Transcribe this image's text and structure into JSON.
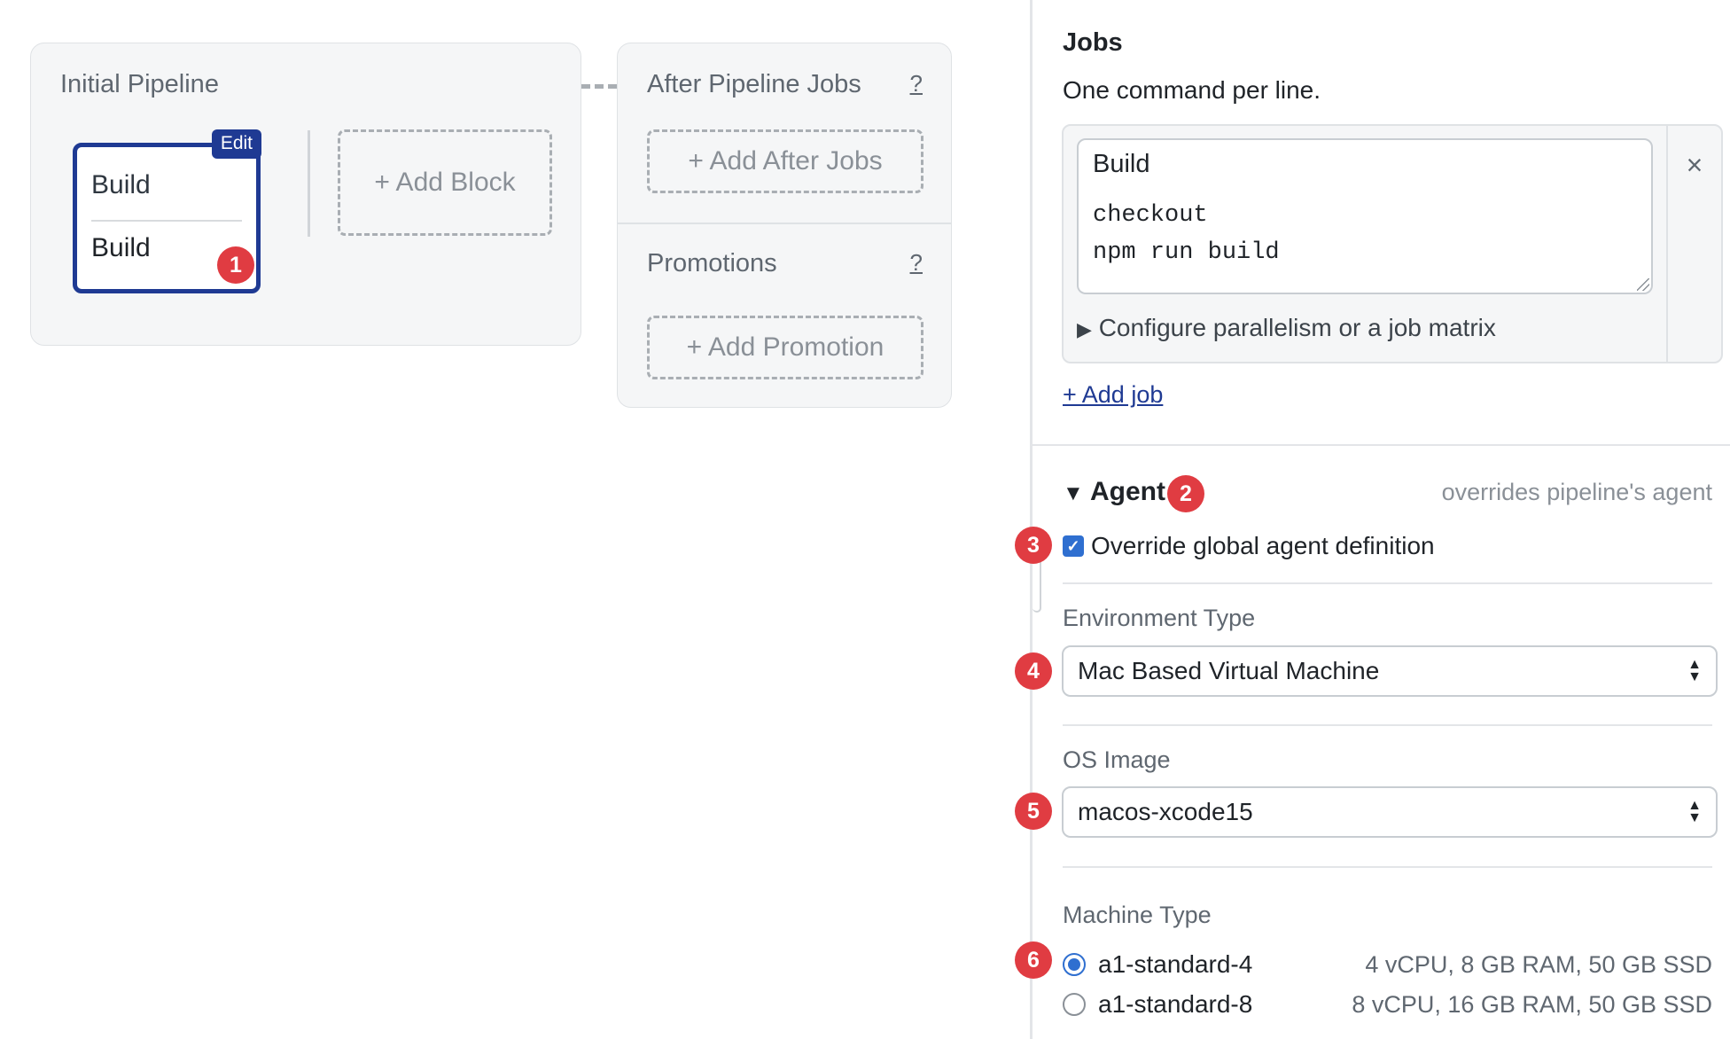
{
  "workflow": {
    "pipeline_title": "Initial Pipeline",
    "block": {
      "edit_label": "Edit",
      "name": "Build",
      "job": "Build",
      "badge": "1"
    },
    "add_block_label": "+ Add Block",
    "after_jobs": {
      "title": "After Pipeline Jobs",
      "help": "?",
      "add_label": "+ Add After Jobs"
    },
    "promotions": {
      "title": "Promotions",
      "help": "?",
      "add_label": "+ Add Promotion"
    }
  },
  "panel": {
    "jobs_title": "Jobs",
    "jobs_subtitle": "One command per line.",
    "job": {
      "name": "Build",
      "commands": "checkout\nnpm run build",
      "close_icon": "×",
      "configure_label": "Configure parallelism or a job matrix"
    },
    "add_job_label": "+ Add job",
    "agent": {
      "title": "Agent",
      "badge": "2",
      "note": "overrides pipeline's agent",
      "override_label": "Override global agent definition",
      "override_checked": true,
      "override_badge": "3",
      "env_type_label": "Environment Type",
      "env_type_value": "Mac Based Virtual Machine",
      "env_type_badge": "4",
      "os_image_label": "OS Image",
      "os_image_value": "macos-xcode15",
      "os_image_badge": "5",
      "machine_type_label": "Machine Type",
      "machine_type_badge": "6",
      "machines": [
        {
          "name": "a1-standard-4",
          "spec": "4 vCPU, 8 GB RAM, 50 GB SSD",
          "selected": true
        },
        {
          "name": "a1-standard-8",
          "spec": "8 vCPU, 16 GB RAM, 50 GB SSD",
          "selected": false
        }
      ]
    }
  },
  "colors": {
    "accent": "#1f3a93",
    "badge": "#e03c42",
    "checkbox": "#2f6fd0"
  }
}
